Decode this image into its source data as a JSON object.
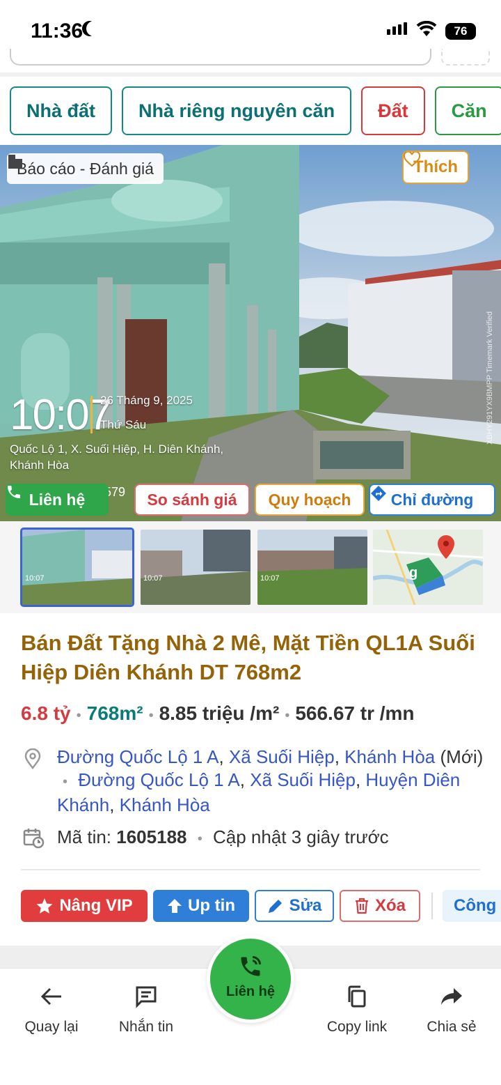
{
  "status_bar": {
    "time": "11:36",
    "battery": "76"
  },
  "tags": [
    {
      "label": "Nhà đất",
      "color": "teal"
    },
    {
      "label": "Nhà riêng nguyên căn",
      "color": "teal"
    },
    {
      "label": "Đất",
      "color": "red"
    },
    {
      "label": "Căn",
      "color": "green"
    }
  ],
  "photo": {
    "report_label": "Báo cáo - Đánh giá",
    "like_label": "Thích",
    "stamp_time": "10:07",
    "stamp_date": "26 Tháng 9, 2025",
    "stamp_day": "Thứ Sáu",
    "stamp_address": "Quốc Lộ 1, X. Suối Hiệp, H. Diên Khánh, Khánh Hòa",
    "stamp_code": "XBHY291YX9BMPP Timemark Verified",
    "stamp_num": "579",
    "buttons": {
      "contact": "Liên hệ",
      "compare": "So sánh giá",
      "planning": "Quy hoạch",
      "directions": "Chỉ đường"
    }
  },
  "thumbnails": [
    {
      "kind": "photo",
      "stamp": "10:07",
      "selected": true
    },
    {
      "kind": "photo",
      "stamp": "10:07",
      "selected": false
    },
    {
      "kind": "photo",
      "stamp": "10:07",
      "selected": false
    },
    {
      "kind": "map",
      "selected": false
    }
  ],
  "listing": {
    "title": "Bán Đất Tặng Nhà 2 Mê, Mặt Tiền QL1A Suối Hiệp Diên Khánh DT 768m2",
    "price": "6.8 tỷ",
    "area": "768m²",
    "price_per_m2": "8.85 triệu /m²",
    "rent": "566.67 tr /mn",
    "address": {
      "new": [
        "Đường Quốc Lộ 1 A",
        "Xã Suối Hiệp",
        "Khánh Hòa"
      ],
      "new_suffix": "(Mới)",
      "old": [
        "Đường Quốc Lộ 1 A",
        "Xã Suối Hiệp",
        "Huyện Diên Khánh",
        "Khánh Hòa"
      ]
    },
    "code_label": "Mã tin:",
    "code": "1605188",
    "updated": "Cập nhật 3 giây trước"
  },
  "actions": {
    "vip": "Nâng VIP",
    "up": "Up tin",
    "edit": "Sửa",
    "delete": "Xóa",
    "public": "Công"
  },
  "bottom_nav": {
    "back": "Quay lại",
    "message": "Nhắn tin",
    "contact": "Liên hệ",
    "copy": "Copy link",
    "share": "Chia sẻ"
  },
  "colors": {
    "teal": "#138a8a",
    "red": "#d9383a",
    "green": "#2fa64a",
    "blue": "#2f7fd8",
    "gold_title": "#946308"
  }
}
